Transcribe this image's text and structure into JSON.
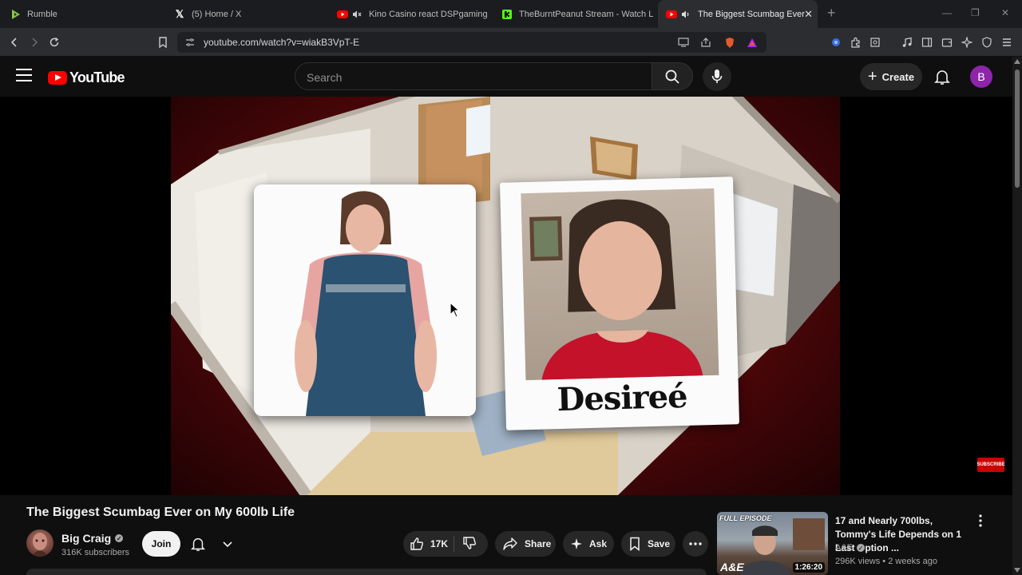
{
  "browser": {
    "tabs": [
      {
        "title": "Rumble",
        "icon": "rumble-icon",
        "color": "#85c742"
      },
      {
        "title": "(5) Home / X",
        "icon": "x-icon",
        "color": "#ffffff"
      },
      {
        "title": "Kino Casino react DSPgamings W",
        "icon": "youtube-muted-icon",
        "color": "#ff0000"
      },
      {
        "title": "TheBurntPeanut Stream - Watch Live",
        "icon": "kick-icon",
        "color": "#53fc18"
      },
      {
        "title": "The Biggest Scumbag Ever on",
        "icon": "youtube-audio-icon",
        "color": "#ff0000",
        "active": true
      }
    ],
    "url": "youtube.com/watch?v=wiakB3VpT-E"
  },
  "header": {
    "logo_text": "YouTube",
    "search_placeholder": "Search",
    "create_label": "Create",
    "avatar_letter": "B",
    "avatar_color": "#8e24aa"
  },
  "player": {
    "caption": "Desireé",
    "badge": "SUBSCRIBE"
  },
  "video": {
    "title": "The Biggest Scumbag Ever on My 600lb Life",
    "channel_name": "Big Craig",
    "subscribers": "316K subscribers",
    "join_label": "Join",
    "like_count": "17K",
    "share_label": "Share",
    "ask_label": "Ask",
    "save_label": "Save"
  },
  "recommendation": {
    "badge": "FULL EPISODE",
    "network_logo": "A&E",
    "duration": "1:26:20",
    "title": "17 and Nearly 700lbs, Tommy's Life Depends on 1 Last Option ...",
    "channel": "A&E",
    "meta": "296K views • 2 weeks ago"
  },
  "colors": {
    "yt_red": "#ff0000",
    "background": "#0f0f0f",
    "pill": "#272727"
  }
}
